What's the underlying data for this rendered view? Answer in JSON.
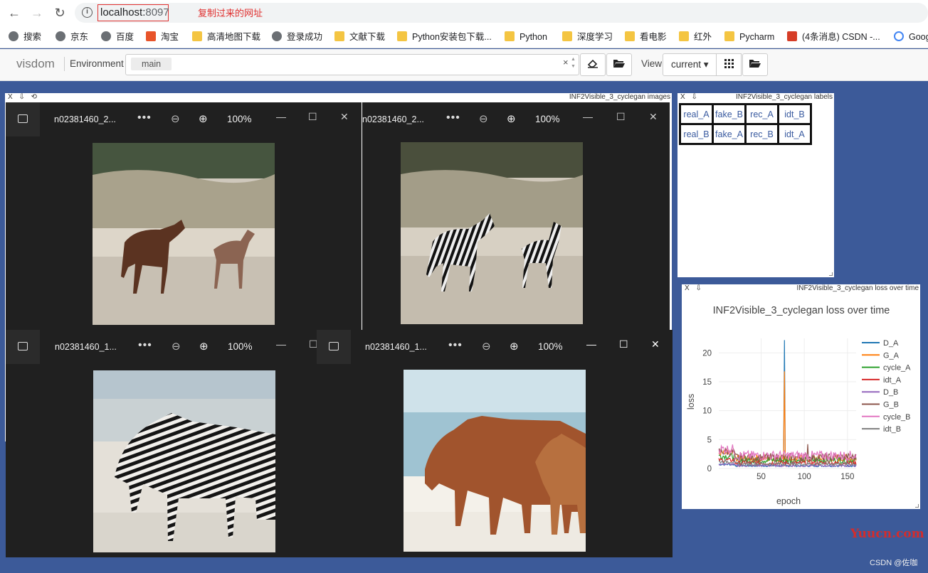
{
  "browser": {
    "url_host": "localhost:",
    "url_port": "8097",
    "annotation": "复制过来的网址",
    "bookmarks": [
      "搜索",
      "京东",
      "百度",
      "淘宝",
      "高清地图下载",
      "登录成功",
      "文献下载",
      "Python安装包下载...",
      "Python",
      "深度学习",
      "看电影",
      "红外",
      "Pycharm",
      "(4条消息) CSDN -...",
      "Goog"
    ]
  },
  "visdom": {
    "brand": "visdom",
    "env_label": "Environment",
    "env_tag": "main",
    "env_clear": "×",
    "view_label": "View",
    "view_select": "current ▾"
  },
  "panes": {
    "images_title": "INF2Visible_3_cyclegan images",
    "labels_title": "INF2Visible_3_cyclegan labels",
    "loss_title": "INF2Visible_3_cyclegan loss over time",
    "pane_controls": "X ⇩ ⟲",
    "labels": [
      [
        "real_A",
        "fake_B",
        "rec_A",
        "idt_B"
      ],
      [
        "real_B",
        "fake_A",
        "rec_B",
        "idt_A"
      ]
    ]
  },
  "viewers": [
    {
      "name": "n02381460_2...",
      "zoom": "100%"
    },
    {
      "name": "n02381460_2...",
      "zoom": "100%"
    },
    {
      "name": "n02381460_1...",
      "zoom": "100%"
    },
    {
      "name": "n02381460_1...",
      "zoom": "100%"
    }
  ],
  "footer": {
    "watermark": "Yuucn.com",
    "credit": "CSDN @佐咖"
  },
  "chart_data": {
    "type": "line",
    "title": "INF2Visible_3_cyclegan loss over time",
    "xlabel": "epoch",
    "ylabel": "loss",
    "xlim": [
      1,
      160
    ],
    "ylim": [
      0,
      22.5
    ],
    "xticks": [
      50,
      100,
      150
    ],
    "yticks": [
      0,
      5,
      10,
      15,
      20
    ],
    "legend_position": "right",
    "series": [
      {
        "name": "D_A",
        "color": "#1f77b4"
      },
      {
        "name": "G_A",
        "color": "#ff7f0e"
      },
      {
        "name": "cycle_A",
        "color": "#2ca02c"
      },
      {
        "name": "idt_A",
        "color": "#d62728"
      },
      {
        "name": "D_B",
        "color": "#9467bd"
      },
      {
        "name": "G_B",
        "color": "#8c564b"
      },
      {
        "name": "cycle_B",
        "color": "#e377c2"
      },
      {
        "name": "idt_B",
        "color": "#7f7f7f"
      }
    ],
    "notable_points": [
      {
        "series": "D_A",
        "x": 77,
        "y": 22.2
      },
      {
        "series": "G_A",
        "x": 77,
        "y": 16.8
      },
      {
        "series": "G_B",
        "x": 104,
        "y": 4.2
      }
    ]
  }
}
